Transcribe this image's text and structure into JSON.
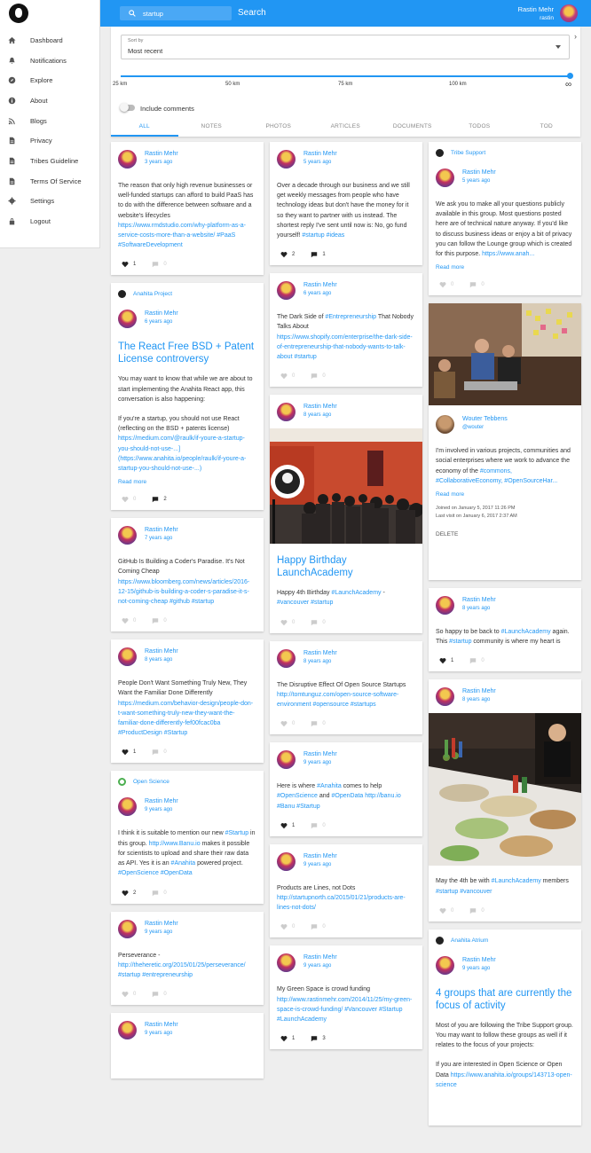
{
  "header": {
    "search_placeholder": "startup",
    "search_value": "startup",
    "search_button": "Search",
    "user_name": "Rastin Mehr",
    "user_handle": "rastin"
  },
  "sidebar": {
    "items": [
      {
        "label": "Dashboard",
        "icon": "home-icon"
      },
      {
        "label": "Notifications",
        "icon": "bell-icon"
      },
      {
        "label": "Explore",
        "icon": "compass-icon"
      },
      {
        "label": "About",
        "icon": "info-icon"
      },
      {
        "label": "Blogs",
        "icon": "rss-icon"
      },
      {
        "label": "Privacy",
        "icon": "document-icon"
      },
      {
        "label": "Tribes Guideline",
        "icon": "document-icon"
      },
      {
        "label": "Terms Of Service",
        "icon": "document-icon"
      },
      {
        "label": "Settings",
        "icon": "gear-icon"
      },
      {
        "label": "Logout",
        "icon": "lock-icon"
      }
    ]
  },
  "filters": {
    "sort_label": "Sort by",
    "sort_value": "Most recent",
    "distance_ticks": [
      "25 km",
      "50 km",
      "75 km",
      "100 km"
    ],
    "distance_value": "infinity",
    "include_comments_label": "Include comments",
    "include_comments": false,
    "tabs": [
      "ALL",
      "NOTES",
      "PHOTOS",
      "ARTICLES",
      "DOCUMENTS",
      "TODOS",
      "TOD"
    ],
    "active_tab": "ALL"
  },
  "col1": [
    {
      "author": "Rastin Mehr",
      "time": "3 years ago",
      "parts": [
        {
          "t": "The reason that only high revenue businesses or well-funded startups can afford to build PaaS has to do with the difference between software and a website's lifecycles "
        },
        {
          "l": "https://www.rmdstudio.com/why-platform-as-a-service-costs-more-than-a-website/ #PaaS #SoftwareDevelopment"
        }
      ],
      "likes": "1",
      "comments": "0",
      "liked": true
    },
    {
      "group": "Anahita Project",
      "author": "Rastin Mehr",
      "time": "6 years ago",
      "title": "The React Free BSD + Patent License controversy",
      "parts": [
        {
          "t": "You may want to know that while we are about to start implementing the Anahita React app, this conversation is also happening:"
        },
        {
          "br": true
        },
        {
          "t": "If you're a startup, you should not use React (reflecting on the BSD + patents license) "
        },
        {
          "l": "https://medium.com/@raulk/if-youre-a-startup-you-should-not-use-...]"
        },
        {
          "t": " "
        },
        {
          "l": "(https://www.anahita.io/people/raulk/if-youre-a-startup-you-should-not-use-...)"
        }
      ],
      "readmore": "Read more",
      "likes": "0",
      "comments": "2",
      "liked": false,
      "commented": true
    },
    {
      "author": "Rastin Mehr",
      "time": "7 years ago",
      "parts": [
        {
          "t": "GitHub Is Building a Coder's Paradise. It's Not Coming Cheap "
        },
        {
          "l": "https://www.bloomberg.com/news/articles/2016-12-15/github-is-building-a-coder-s-paradise-it-s-not-coming-cheap #github #startup"
        }
      ],
      "likes": "0",
      "comments": "0",
      "liked": false
    },
    {
      "author": "Rastin Mehr",
      "time": "8 years ago",
      "parts": [
        {
          "t": "People Don't Want Something Truly New, They Want the Familiar Done Differently "
        },
        {
          "l": "https://medium.com/behavior-design/people-don-t-want-something-truly-new-they-want-the-familiar-done-differently-fef00fcac0ba #ProductDesign #Startup"
        }
      ],
      "likes": "1",
      "comments": "0",
      "liked": true
    },
    {
      "group": "Open Science",
      "group_icon": "green",
      "author": "Rastin Mehr",
      "time": "9 years ago",
      "parts": [
        {
          "t": "I think it is suitable to mention our new "
        },
        {
          "l": "#Startup"
        },
        {
          "t": " in this group. "
        },
        {
          "l": "http://www.Banu.io"
        },
        {
          "t": " makes it possible for scientists to upload and share their raw data as API. Yes it is an "
        },
        {
          "l": "#Anahita"
        },
        {
          "t": " powered project. "
        },
        {
          "l": "#OpenScience #OpenData"
        }
      ],
      "likes": "2",
      "comments": "0",
      "liked": true
    },
    {
      "author": "Rastin Mehr",
      "time": "9 years ago",
      "parts": [
        {
          "t": "Perseverance - "
        },
        {
          "l": "http://theheretic.org/2015/01/25/perseverance/ #startup #entrepreneurship"
        }
      ],
      "likes": "0",
      "comments": "0",
      "liked": false
    },
    {
      "author": "Rastin Mehr",
      "time": "9 years ago",
      "parts": [],
      "likes": "",
      "comments": "",
      "partial": true
    }
  ],
  "col2": [
    {
      "author": "Rastin Mehr",
      "time": "5 years ago",
      "parts": [
        {
          "t": "Over a decade through our business and we still get weekly messages from people who have technology ideas but don't have the money for it so they want to partner with us instead. The shortest reply I've sent until now is: No, go fund yourself! "
        },
        {
          "l": "#startup #ideas"
        }
      ],
      "likes": "2",
      "comments": "1",
      "liked": true,
      "commented": true
    },
    {
      "author": "Rastin Mehr",
      "time": "6 years ago",
      "parts": [
        {
          "t": "The Dark Side of "
        },
        {
          "l": "#Entrepreneurship"
        },
        {
          "t": " That Nobody Talks About "
        },
        {
          "l": "https://www.shopify.com/enterprise/the-dark-side-of-entrepreneurship-that-nobody-wants-to-talk-about #startup"
        }
      ],
      "likes": "0",
      "comments": "0",
      "liked": false
    },
    {
      "author": "Rastin Mehr",
      "time": "8 years ago",
      "photo": "launch",
      "title": "Happy Birthday LaunchAcademy",
      "parts": [
        {
          "t": "Happy 4th Birthday "
        },
        {
          "l": "#LaunchAcademy"
        },
        {
          "t": " - "
        },
        {
          "l": "#vancouver #startup"
        }
      ],
      "likes": "0",
      "comments": "0",
      "liked": false
    },
    {
      "author": "Rastin Mehr",
      "time": "8 years ago",
      "parts": [
        {
          "t": "The Disruptive Effect Of Open Source Startups "
        },
        {
          "l": "http://tomtunguz.com/open-source-software-environment #opensource #startups"
        }
      ],
      "likes": "0",
      "comments": "0",
      "liked": false
    },
    {
      "author": "Rastin Mehr",
      "time": "9 years ago",
      "parts": [
        {
          "t": "Here is where "
        },
        {
          "l": "#Anahita"
        },
        {
          "t": " comes to help "
        },
        {
          "l": "#OpenScience"
        },
        {
          "t": " and "
        },
        {
          "l": "#OpenData http://banu.io #Banu #Startup"
        }
      ],
      "likes": "1",
      "comments": "0",
      "liked": true
    },
    {
      "author": "Rastin Mehr",
      "time": "9 years ago",
      "parts": [
        {
          "t": "Products are Lines, not Dots "
        },
        {
          "l": "http://startupnorth.ca/2015/01/21/products-are-lines-not-dots/"
        }
      ],
      "likes": "0",
      "comments": "0",
      "liked": false
    },
    {
      "author": "Rastin Mehr",
      "time": "9 years ago",
      "parts": [
        {
          "t": "My Green Space is crowd funding "
        },
        {
          "l": "http://www.rastinmehr.com/2014/11/25/my-green-space-is-crowd-funding/ #Vancouver #Startup #LaunchAcademy"
        }
      ],
      "likes": "1",
      "comments": "3",
      "liked": true,
      "commented": true
    }
  ],
  "col3": [
    {
      "group": "Tribe Support",
      "author": "Rastin Mehr",
      "time": "5 years ago",
      "parts": [
        {
          "t": "We ask you to make all your questions publicly available in this group. Most questions posted here are of technical nature anyway. If you'd like to discuss business ideas or enjoy a bit of privacy you can follow the Lounge group which is created for this purpose. "
        },
        {
          "l": "https://www.anah..."
        }
      ],
      "readmore": "Read more",
      "likes": "0",
      "comments": "0",
      "liked": false
    },
    {
      "photo_top": "meeting",
      "author": "Wouter Tebbens",
      "time": "@wouter",
      "avatar": "wouter",
      "parts": [
        {
          "t": "I'm involved in various projects, communities and social enterprises where we work to advance the economy of the "
        },
        {
          "l": "#commons, #CollaborativeEconomy, #OpenSourceHar..."
        }
      ],
      "readmore": "Read more",
      "joined": "Joined on January 5, 2017 11:26 PM",
      "lastvisit": "Last visit on January 6, 2017 2:37 AM",
      "delete": "DELETE"
    },
    {
      "author": "Rastin Mehr",
      "time": "8 years ago",
      "parts": [
        {
          "t": "So happy to be back to "
        },
        {
          "l": "#LaunchAcademy"
        },
        {
          "t": " again. This "
        },
        {
          "l": "#startup"
        },
        {
          "t": " community is where my heart is"
        }
      ],
      "likes": "1",
      "comments": "0",
      "liked": true
    },
    {
      "author": "Rastin Mehr",
      "time": "8 years ago",
      "photo": "buffet",
      "parts": [
        {
          "t": "May the 4th be with "
        },
        {
          "l": "#LaunchAcademy"
        },
        {
          "t": " members "
        },
        {
          "l": "#startup #vancouver"
        }
      ],
      "likes": "0",
      "comments": "0",
      "liked": false
    },
    {
      "group": "Anahita Atrium",
      "author": "Rastin Mehr",
      "time": "9 years ago",
      "title": "4 groups that are currently the focus of activity",
      "parts": [
        {
          "t": "Most of you are following the Tribe Support group. You may want to follow these groups as well if it relates to the focus of your projects:"
        },
        {
          "br": true
        },
        {
          "t": "If you are interested in Open Science or Open Data "
        },
        {
          "l": "https://www.anahita.io/groups/143713-open-science"
        }
      ],
      "partial": true
    }
  ],
  "colors": {
    "accent": "#2196f3",
    "background": "#eeeeee"
  }
}
